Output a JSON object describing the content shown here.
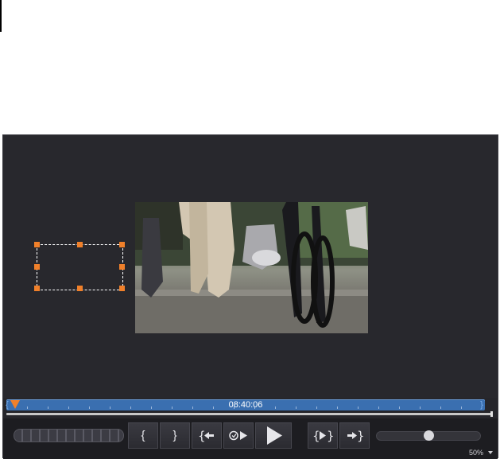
{
  "timeline": {
    "timecode": "08:40:06",
    "playhead_position": 0.01,
    "accent_color": "#3a6fb0",
    "playhead_color": "#f0802a"
  },
  "controls": {
    "mark_in_label": "{",
    "mark_out_label": "}",
    "go_to_mark_in_icon": "go-to-in-icon",
    "loop_play_icon": "loop-play-icon",
    "play_icon": "play-icon",
    "play_between_marks_icon": "play-between-marks-icon",
    "go_to_mark_out_icon": "go-to-out-icon",
    "volume_level": 0.5
  },
  "zoom": {
    "value": "50%"
  }
}
